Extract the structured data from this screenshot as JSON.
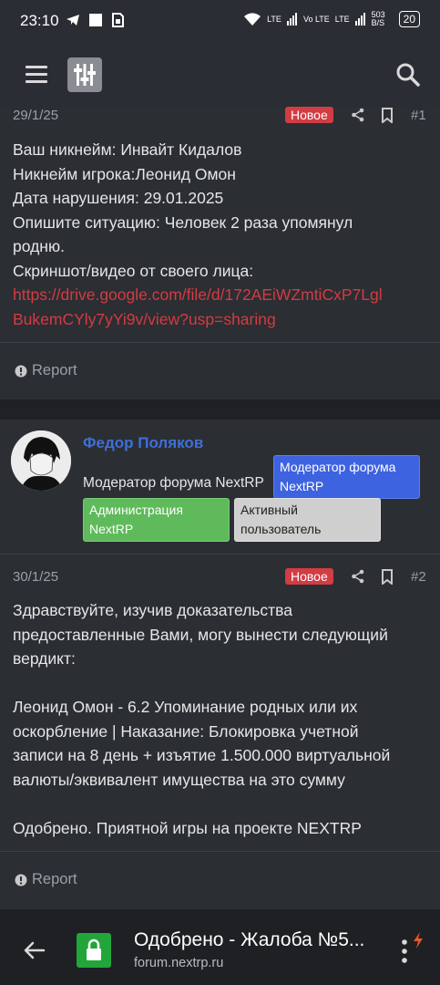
{
  "status_bar": {
    "time": "23:10",
    "network_speed": "503 B/S",
    "battery": "20",
    "signals": [
      "LTE",
      "Vo LTE",
      "LTE"
    ]
  },
  "post1": {
    "date": "29/1/25",
    "badge": "Новое",
    "number": "#1",
    "lines": [
      "Ваш никнейм: Инвайт Кидалов",
      "Никнейм игрока:Леонид Омон",
      "Дата нарушения: 29.01.2025",
      "Опишите ситуацию: Человек 2 раза упомянул",
      "родню.",
      "Скриншот/видео от своего лица:"
    ],
    "link_line1": "https://drive.google.com/file/d/172AEiWZmtiCxP7Lgl",
    "link_line2": "BukemCYly7yYi9v/view?usp=sharing",
    "report": "Report"
  },
  "user": {
    "name": "Федор Поляков",
    "title": "Модератор форума NextRP",
    "badges": [
      {
        "label_line1": "Модератор форума",
        "label_line2": "NextRP",
        "color": "#3e63e0"
      },
      {
        "label_line1": "Администрация",
        "label_line2": "NextRP",
        "color": "#5fba5c"
      },
      {
        "label_line1": "Активный",
        "label_line2": "пользователь",
        "color": "#cfcfcf"
      }
    ]
  },
  "post2": {
    "date": "30/1/25",
    "badge": "Новое",
    "number": "#2",
    "lines": [
      "Здравствуйте, изучив доказательства",
      "предоставленные Вами, могу вынести следующий",
      "вердикт:",
      "",
      "Леонид Омон - 6.2 Упоминание родных или их",
      "оскорбление | Наказание: Блокировка учетной",
      "записи на 8 день + изъятие 1.500.000 виртуальной",
      "валюты/эквивалент имущества на это сумму",
      "",
      "Одобрено. Приятной игры на проекте NEXTRP"
    ],
    "report": "Report"
  },
  "browser": {
    "title": "Одобрено - Жалоба №5...",
    "url": "forum.nextrp.ru"
  },
  "colors": {
    "accent_red": "#d43b42",
    "username_blue": "#3e6fd9",
    "lock_green": "#22a63a"
  }
}
